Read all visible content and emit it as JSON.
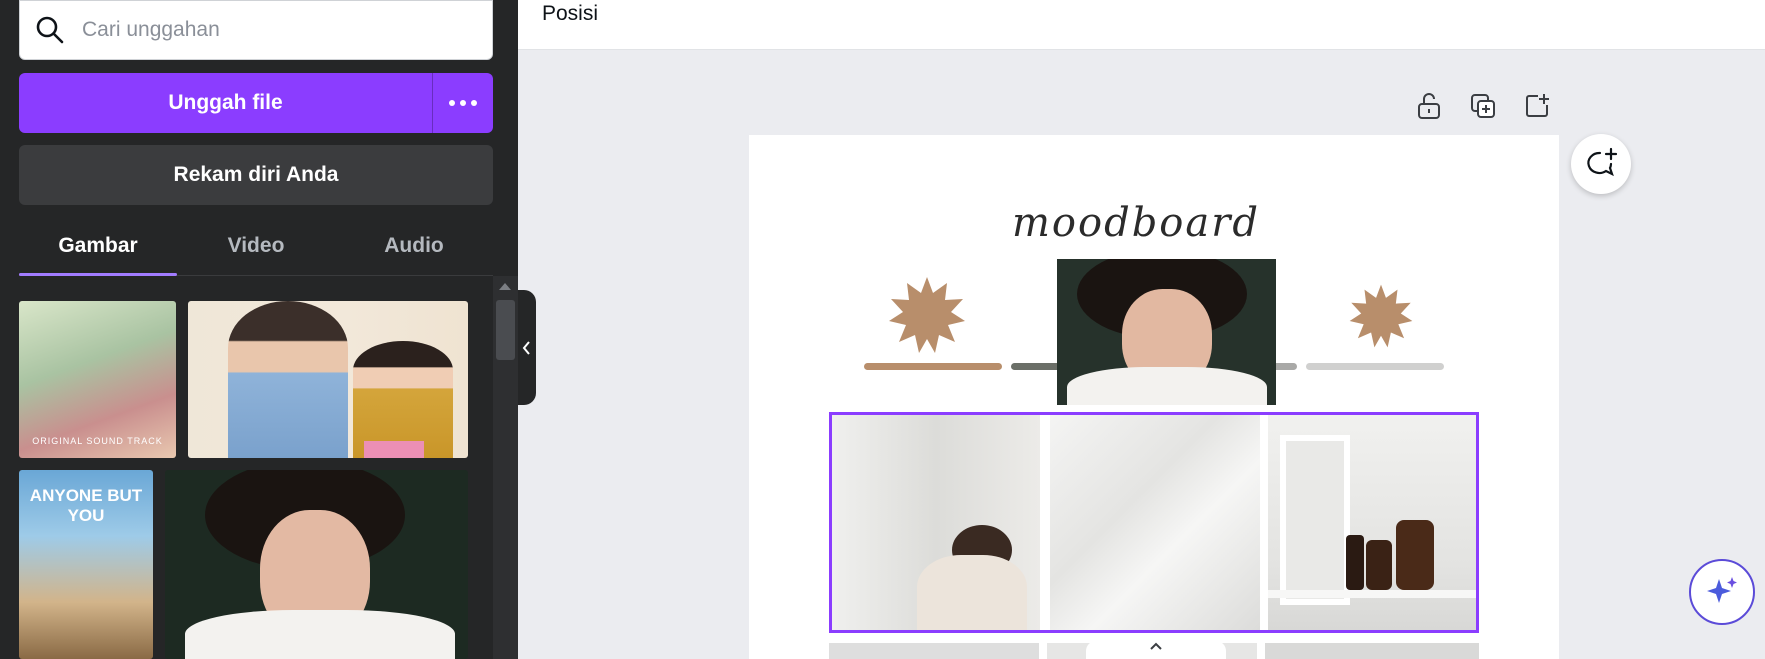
{
  "sidebar": {
    "search": {
      "placeholder": "Cari unggahan"
    },
    "upload_label": "Unggah file",
    "record_label": "Rekam diri Anda",
    "tabs": [
      {
        "label": "Gambar",
        "active": true
      },
      {
        "label": "Video",
        "active": false
      },
      {
        "label": "Audio",
        "active": false
      }
    ],
    "thumbnails": [
      {
        "caption": "ORIGINAL SOUND TRACK"
      },
      {
        "caption": ""
      },
      {
        "title": "ANYONE BUT YOU"
      },
      {
        "caption": ""
      }
    ]
  },
  "topbar": {
    "position_label": "Posisi"
  },
  "design": {
    "title": "moodboard",
    "accent_color": "#b88e6b",
    "selection_color": "#8b3dff"
  },
  "icons": {
    "search": "search-icon",
    "more": "more-horizontal-icon",
    "collapse": "chevron-left-icon",
    "lock": "unlock-icon",
    "duplicate": "duplicate-page-icon",
    "add_page": "add-page-icon",
    "comment": "add-comment-icon",
    "magic": "sparkle-icon",
    "handle": "chevron-up-icon"
  }
}
